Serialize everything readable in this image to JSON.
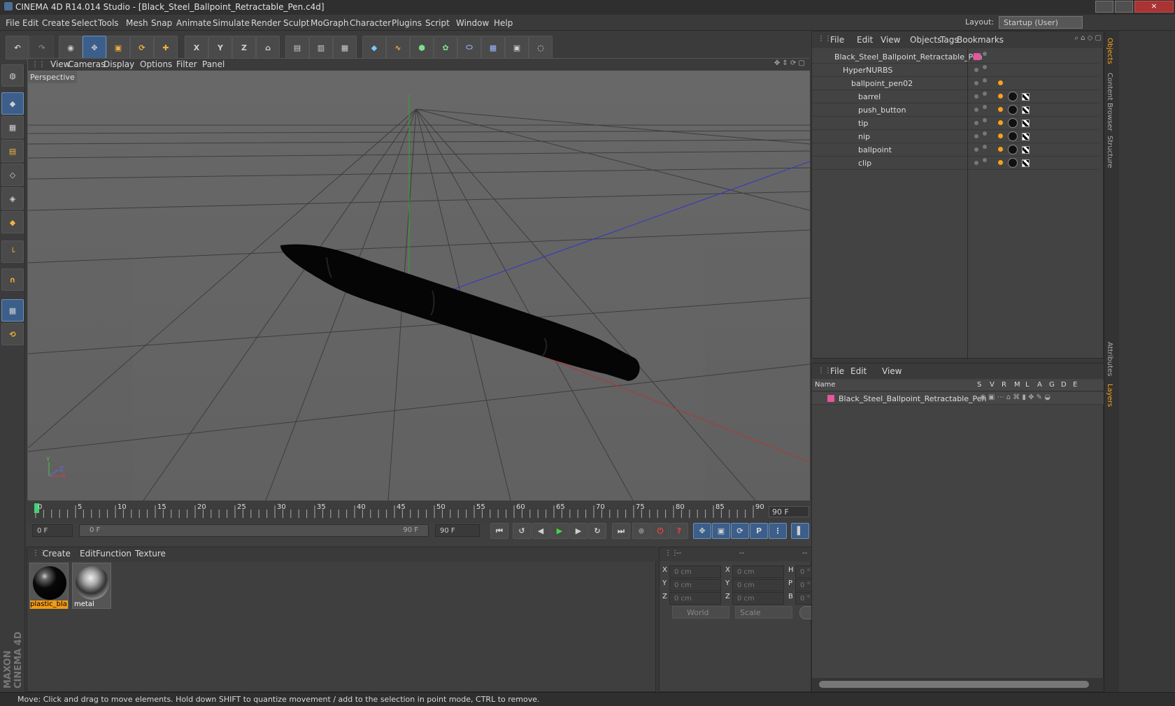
{
  "window": {
    "title": "CINEMA 4D R14.014 Studio - [Black_Steel_Ballpoint_Retractable_Pen.c4d]",
    "layout_label": "Layout:",
    "layout_value": "Startup (User)"
  },
  "menu": [
    "File",
    "Edit",
    "Create",
    "Select",
    "Tools",
    "Mesh",
    "Snap",
    "Animate",
    "Simulate",
    "Render",
    "Sculpt",
    "MoGraph",
    "Character",
    "Plugins",
    "Script",
    "Window",
    "Help"
  ],
  "viewport": {
    "menus": [
      "View",
      "Cameras",
      "Display",
      "Options",
      "Filter",
      "Panel"
    ],
    "name": "Perspective"
  },
  "timeline": {
    "ticks": [
      "0",
      "5",
      "10",
      "15",
      "20",
      "25",
      "30",
      "35",
      "40",
      "45",
      "50",
      "55",
      "60",
      "65",
      "70",
      "75",
      "80",
      "85",
      "90"
    ],
    "current": "0 F",
    "start": "0 F",
    "end": "90 F",
    "range_start": "0 F",
    "range_end": "90 F",
    "max": "90 F"
  },
  "materials": {
    "menus": [
      "Create",
      "Edit",
      "Function",
      "Texture"
    ],
    "items": [
      {
        "name": "plastic_bla"
      },
      {
        "name": "metal"
      }
    ]
  },
  "coords": {
    "headers": [
      "--",
      "--",
      "--"
    ],
    "labels": [
      "X",
      "Y",
      "Z"
    ],
    "pos": [
      "0 cm",
      "0 cm",
      "0 cm"
    ],
    "size": [
      "0 cm",
      "0 cm",
      "0 cm"
    ],
    "rot_labels": [
      "H",
      "P",
      "B"
    ],
    "rot": [
      "0 °",
      "0 °",
      "0 °"
    ],
    "mode": "World",
    "scale": "Scale",
    "apply": "Apply"
  },
  "objects": {
    "menus": [
      "File",
      "Edit",
      "View",
      "Objects",
      "Tags",
      "Bookmarks"
    ],
    "rows": [
      "Black_Steel_Ballpoint_Retractable_Pen",
      "HyperNURBS",
      "ballpoint_pen02",
      "barrel",
      "push_button",
      "tip",
      "nip",
      "ballpoint",
      "clip"
    ]
  },
  "layers": {
    "menus": [
      "File",
      "Edit",
      "View"
    ],
    "columns": [
      "Name",
      "S",
      "V",
      "R",
      "M",
      "L",
      "A",
      "G",
      "D",
      "E"
    ],
    "item": "Black_Steel_Ballpoint_Retractable_Pen"
  },
  "side_tabs": [
    "Objects",
    "Content Browser",
    "Structure",
    "Attributes",
    "Layers"
  ],
  "brand": "MAXON CINEMA 4D",
  "status": "Move: Click and drag to move elements. Hold down SHIFT to quantize movement / add to the selection in point mode, CTRL to remove."
}
